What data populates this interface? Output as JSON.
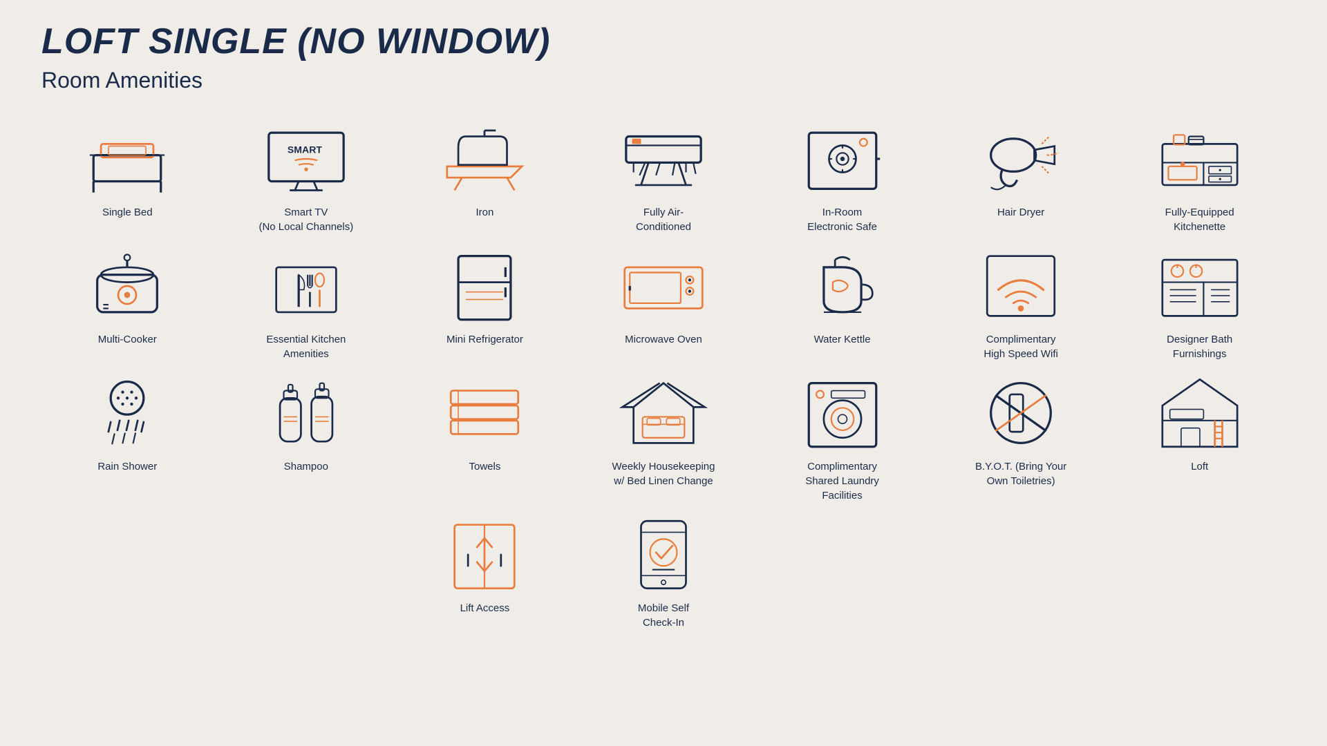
{
  "page": {
    "title": "LOFT SINGLE (NO WINDOW)",
    "subtitle": "Room Amenities"
  },
  "amenities": [
    {
      "id": "single-bed",
      "label": "Single Bed"
    },
    {
      "id": "smart-tv",
      "label": "Smart TV\n(No Local Channels)"
    },
    {
      "id": "iron",
      "label": "Iron"
    },
    {
      "id": "air-conditioned",
      "label": "Fully Air-\nConditioned"
    },
    {
      "id": "electronic-safe",
      "label": "In-Room\nElectronic Safe"
    },
    {
      "id": "hair-dryer",
      "label": "Hair Dryer"
    },
    {
      "id": "kitchenette",
      "label": "Fully-Equipped\nKitchenette"
    },
    {
      "id": "multi-cooker",
      "label": "Multi-Cooker"
    },
    {
      "id": "kitchen-amenities",
      "label": "Essential Kitchen\nAmenities"
    },
    {
      "id": "mini-fridge",
      "label": "Mini Refrigerator"
    },
    {
      "id": "microwave",
      "label": "Microwave Oven"
    },
    {
      "id": "water-kettle",
      "label": "Water Kettle"
    },
    {
      "id": "wifi",
      "label": "Complimentary\nHigh Speed Wifi"
    },
    {
      "id": "bath-furnishings",
      "label": "Designer Bath\nFurnishings"
    },
    {
      "id": "rain-shower",
      "label": "Rain Shower"
    },
    {
      "id": "shampoo",
      "label": "Shampoo"
    },
    {
      "id": "towels",
      "label": "Towels"
    },
    {
      "id": "housekeeping",
      "label": "Weekly Housekeeping\nw/ Bed Linen Change"
    },
    {
      "id": "laundry",
      "label": "Complimentary\nShared Laundry\nFacilities"
    },
    {
      "id": "byot",
      "label": "B.Y.O.T. (Bring Your\nOwn Toiletries)"
    },
    {
      "id": "loft",
      "label": "Loft"
    },
    {
      "id": "spacer1",
      "label": ""
    },
    {
      "id": "spacer2",
      "label": ""
    },
    {
      "id": "lift",
      "label": "Lift Access"
    },
    {
      "id": "mobile-checkin",
      "label": "Mobile Self\nCheck-In"
    },
    {
      "id": "spacer3",
      "label": ""
    },
    {
      "id": "spacer4",
      "label": ""
    },
    {
      "id": "spacer5",
      "label": ""
    }
  ],
  "colors": {
    "navy": "#1a2b4a",
    "orange": "#e87d3e",
    "bg": "#f0ede8"
  }
}
